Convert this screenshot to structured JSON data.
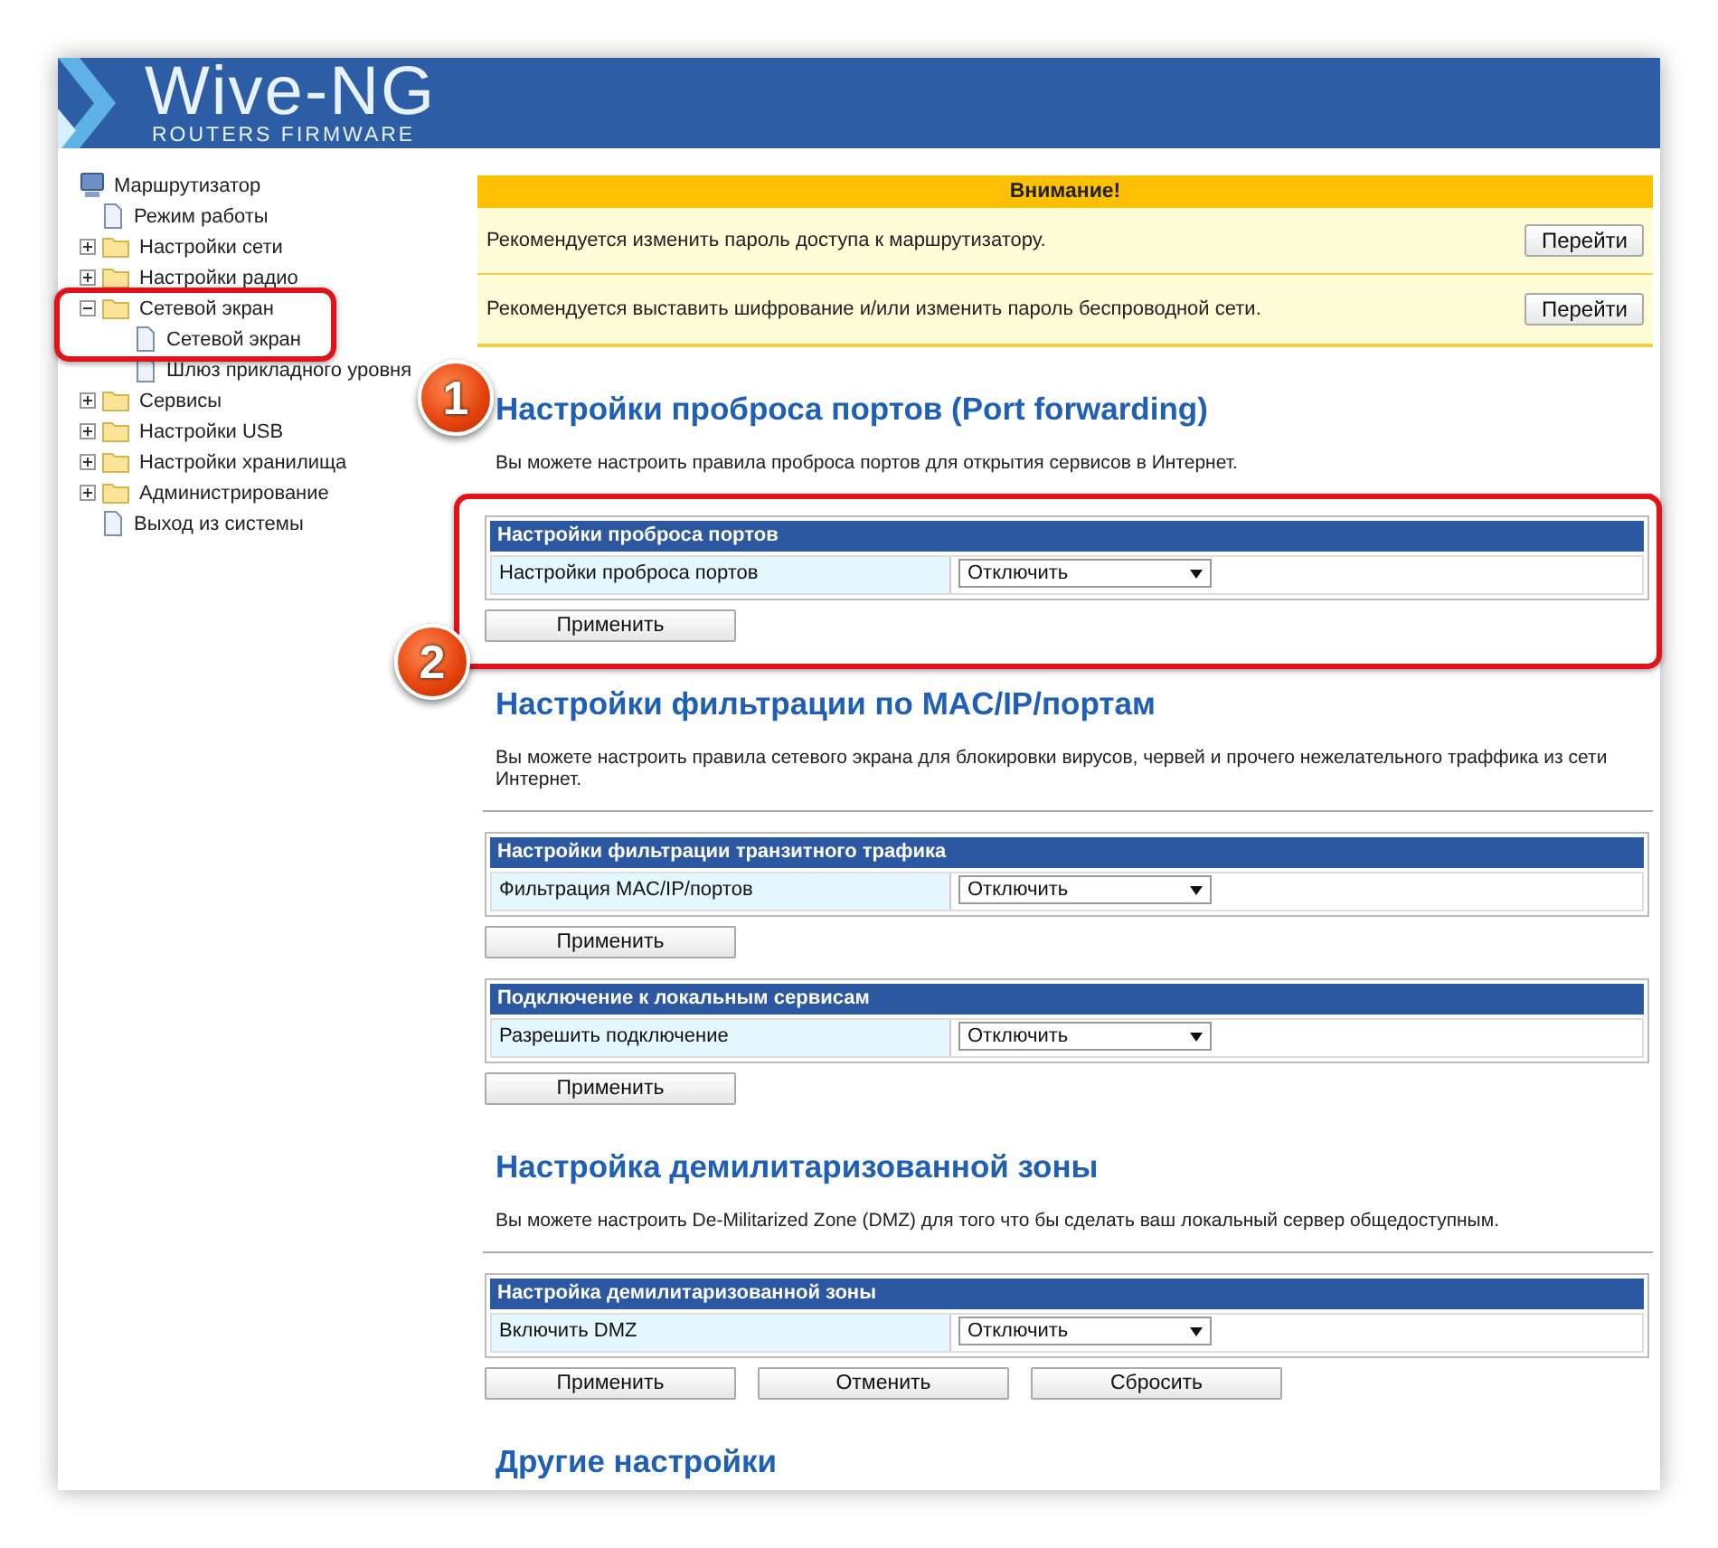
{
  "header": {
    "logo_title": "Wive-NG",
    "logo_subtitle": "ROUTERS FIRMWARE"
  },
  "sidebar": {
    "tree": [
      {
        "label": "Маршрутизатор",
        "kind": "root",
        "children": [
          {
            "label": "Режим работы",
            "kind": "page"
          },
          {
            "label": "Настройки сети",
            "kind": "folder",
            "expanded": false
          },
          {
            "label": "Настройки радио",
            "kind": "folder",
            "expanded": false
          },
          {
            "label": "Сетевой экран",
            "kind": "folder",
            "expanded": true,
            "children": [
              {
                "label": "Сетевой экран",
                "kind": "page"
              },
              {
                "label": "Шлюз прикладного уровня",
                "kind": "page"
              }
            ]
          },
          {
            "label": "Сервисы",
            "kind": "folder",
            "expanded": false
          },
          {
            "label": "Настройки USB",
            "kind": "folder",
            "expanded": false
          },
          {
            "label": "Настройки хранилища",
            "kind": "folder",
            "expanded": false
          },
          {
            "label": "Администрирование",
            "kind": "folder",
            "expanded": false
          },
          {
            "label": "Выход из системы",
            "kind": "page"
          }
        ]
      }
    ]
  },
  "alert": {
    "title": "Внимание!",
    "rows": [
      {
        "text": "Рекомендуется изменить пароль доступа к маршрутизатору.",
        "button": "Перейти"
      },
      {
        "text": "Рекомендуется выставить шифрование и/или изменить пароль беспроводной сети.",
        "button": "Перейти"
      }
    ]
  },
  "sections": [
    {
      "title": "Настройки проброса портов (Port forwarding)",
      "description": "Вы можете настроить правила проброса портов для открытия сервисов в Интернет.",
      "tables": [
        {
          "header": "Настройки проброса портов",
          "rows": [
            {
              "label": "Настройки проброса портов",
              "value": "Отключить"
            }
          ],
          "buttons": [
            "Применить"
          ]
        }
      ]
    },
    {
      "title": "Настройки фильтрации по MAC/IP/портам",
      "description": "Вы можете настроить правила сетевого экрана для блокировки вирусов, червей и прочего нежелательного траффика из сети Интернет.",
      "tables": [
        {
          "header": "Настройки фильтрации транзитного трафика",
          "rows": [
            {
              "label": "Фильтрация MAC/IP/портов",
              "value": "Отключить"
            }
          ],
          "buttons": [
            "Применить"
          ]
        },
        {
          "header": "Подключение к локальным сервисам",
          "rows": [
            {
              "label": "Разрешить подключение",
              "value": "Отключить"
            }
          ],
          "buttons": [
            "Применить"
          ]
        }
      ]
    },
    {
      "title": "Настройка демилитаризованной зоны",
      "description": "Вы можете настроить De-Militarized Zone (DMZ) для того что бы сделать ваш локальный сервер общедоступным.",
      "tables": [
        {
          "header": "Настройка демилитаризованной зоны",
          "rows": [
            {
              "label": "Включить DMZ",
              "value": "Отключить"
            }
          ],
          "buttons": [
            "Применить",
            "Отменить",
            "Сбросить"
          ]
        }
      ]
    },
    {
      "title": "Другие настройки"
    }
  ],
  "annotations": [
    {
      "label": "1"
    },
    {
      "label": "2"
    }
  ]
}
